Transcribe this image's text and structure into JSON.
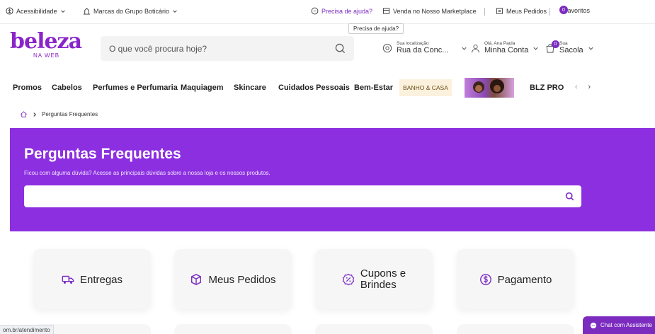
{
  "topbar": {
    "accessibility": "Acessibilidade",
    "brands": "Marcas do Grupo Boticário",
    "help": "Precisa de ajuda?",
    "marketplace": "Venda no Nosso Marketplace",
    "orders": "Meus Pedidos",
    "favorites": "Favoritos",
    "favorites_count": "0",
    "tooltip": "Precisa de ajuda?"
  },
  "header": {
    "logo_main": "beleza",
    "logo_sub": "NA WEB",
    "search_placeholder": "O que você procura hoje?",
    "location_small": "Sua localização",
    "location_value": "Rua da Conc...",
    "account_small": "Olá, Ana Paula",
    "account_value": "Minha Conta",
    "bag_small": "Sua",
    "bag_value": "Sacola",
    "bag_count": "0"
  },
  "nav": {
    "items": [
      "Promos",
      "Cabelos",
      "Perfumes e Perfumaria",
      "Maquiagem",
      "Skincare",
      "Cuidados Pessoais",
      "Bem-Estar"
    ],
    "banho": "BANHO & CASA",
    "blzpro": "BLZ PRO"
  },
  "breadcrumb": {
    "current": "Perguntas Frequentes"
  },
  "banner": {
    "title": "Perguntas Frequentes",
    "subtitle": "Ficou com alguma dúvida? Acesse as principais dúvidas sobre a nossa loja e os nossos produtos.",
    "search_placeholder": ""
  },
  "cards": [
    {
      "label": "Entregas",
      "icon": "truck-icon"
    },
    {
      "label": "Meus Pedidos",
      "icon": "box-icon"
    },
    {
      "label_line1": "Cupons e",
      "label_line2": "Brindes",
      "icon": "coupon-icon"
    },
    {
      "label": "Pagamento",
      "icon": "dollar-icon"
    }
  ],
  "status_url": "om.br/atendimento",
  "chat": {
    "label": "Chat com Assistente"
  },
  "colors": {
    "brand_purple": "#8c2fe0",
    "accent_purple": "#7b2cbf"
  }
}
